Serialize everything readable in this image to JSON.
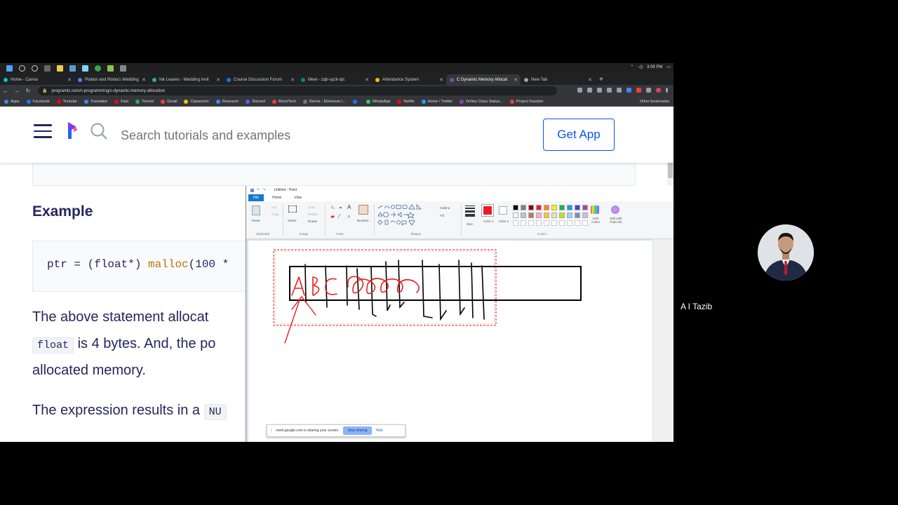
{
  "taskbar": {
    "clock": "3:09 PM"
  },
  "browser": {
    "tabs": [
      {
        "title": "Home - Canva",
        "color": "#00c4cc"
      },
      {
        "title": "Plabon and Risha's Wedding",
        "color": "#4285f4"
      },
      {
        "title": "Ink Leaves - Wedding Invit",
        "color": "#2bb673"
      },
      {
        "title": "Course Discussion Forum",
        "color": "#1a73e8"
      },
      {
        "title": "Meet - zqb-uyzk-qtc",
        "color": "#00897b"
      },
      {
        "title": "Attendance System",
        "color": "#fbbc04"
      },
      {
        "title": "C Dynamic Memory Allocat",
        "color": "#8e44ad"
      },
      {
        "title": "New Tab",
        "color": "#9aa0a6"
      }
    ],
    "url": "programiz.com/c-programming/c-dynamic-memory-allocation",
    "bookmarks": [
      {
        "label": "Apps",
        "color": "#4285f4"
      },
      {
        "label": "Facebook",
        "color": "#1877f2"
      },
      {
        "label": "Youtube",
        "color": "#ff0000"
      },
      {
        "label": "Translator",
        "color": "#4285f4"
      },
      {
        "label": "Fast",
        "color": "#e50914"
      },
      {
        "label": "Torrent",
        "color": "#34a853"
      },
      {
        "label": "Gmail",
        "color": "#ea4335"
      },
      {
        "label": "Classroom",
        "color": "#fbbc04"
      },
      {
        "label": "Research",
        "color": "#4285f4"
      },
      {
        "label": "Discord",
        "color": "#5865f2"
      },
      {
        "label": "BlockTech",
        "color": "#ea4335"
      },
      {
        "label": "Remix - Ethereum I...",
        "color": "#777777"
      },
      {
        "label": "",
        "color": "#1877f2"
      },
      {
        "label": "WhatsApp",
        "color": "#25d366"
      },
      {
        "label": "Netflix",
        "color": "#e50914"
      },
      {
        "label": "Home / Twitter",
        "color": "#1da1f2"
      },
      {
        "label": "Online Class Status...",
        "color": "#8e44ad"
      },
      {
        "label": "Project Fauston",
        "color": "#ea4335"
      }
    ],
    "other_bookmarks": "Other bookmarks"
  },
  "site": {
    "search_placeholder": "Search tutorials and examples",
    "get_app": "Get App",
    "example_heading": "Example",
    "code_prefix": "ptr = (float*) ",
    "code_fn": "malloc",
    "code_suffix": "(100 *",
    "para1": "The above statement allocat",
    "para2_code": "float",
    "para2_text": " is 4 bytes. And, the po",
    "para3": "allocated memory.",
    "para4_text": "The expression results in a ",
    "para4_code": "NU"
  },
  "paint": {
    "title": "Untitled - Paint",
    "menu_file": "File",
    "menu_home": "Home",
    "menu_view": "View",
    "groups": {
      "clipboard": "Clipboard",
      "image": "Image",
      "tools": "Tools",
      "shapes": "Shapes",
      "colors": "Colors"
    },
    "labels": {
      "paste": "Paste",
      "cut": "Cut",
      "copy": "Copy",
      "select": "Select",
      "crop": "Crop",
      "resize": "Resize",
      "rotate": "Rotate",
      "brushes": "Brushes",
      "outline": "Outline",
      "fill": "Fill",
      "size": "Size",
      "color1": "Color 1",
      "color2": "Color 2",
      "edit_colors": "Edit colors",
      "edit_paint3d": "Edit with Paint 3D"
    },
    "palette": [
      "#000000",
      "#7f7f7f",
      "#880015",
      "#ed1c24",
      "#ff7f27",
      "#fff200",
      "#22b14c",
      "#00a2e8",
      "#3f48cc",
      "#a349a4",
      "#ffffff",
      "#c3c3c3",
      "#b97a57",
      "#ffaec9",
      "#ffc90e",
      "#efe4b0",
      "#b5e61d",
      "#99d9ea",
      "#7092be",
      "#c8bfe7"
    ],
    "drawing_text": "ABC"
  },
  "share_bar": {
    "message": "meet.google.com is sharing your screen.",
    "stop": "Stop sharing",
    "hide": "Hide"
  },
  "participant": {
    "name": "A I Tazib"
  }
}
